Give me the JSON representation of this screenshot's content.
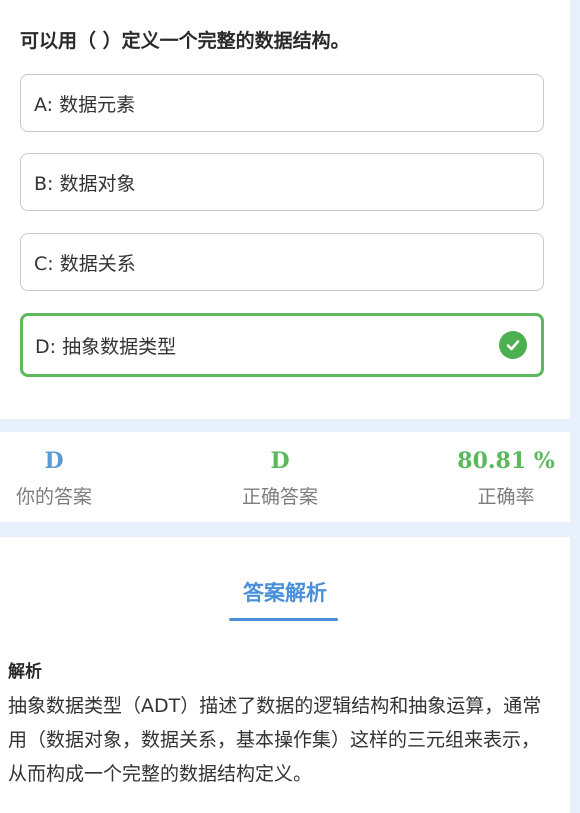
{
  "question": {
    "text": "可以用（ ）定义一个完整的数据结构。",
    "options": [
      {
        "label": "A: 数据元素",
        "correct": false
      },
      {
        "label": "B: 数据对象",
        "correct": false
      },
      {
        "label": "C: 数据关系",
        "correct": false
      },
      {
        "label": "D: 抽象数据类型",
        "correct": true
      }
    ],
    "correct_icon": "check-circle-icon"
  },
  "stats": {
    "your_answer": {
      "value": "D",
      "label": "你的答案"
    },
    "correct_answer": {
      "value": "D",
      "label": "正确答案"
    },
    "accuracy": {
      "value": "80.81 %",
      "label": "正确率"
    }
  },
  "analysis": {
    "title": "答案解析",
    "heading": "解析",
    "body": "抽象数据类型（ADT）描述了数据的逻辑结构和抽象运算，通常用（数据对象，数据关系，基本操作集）这样的三元组来表示，从而构成一个完整的数据结构定义。"
  },
  "colors": {
    "page_bg": "#e8f1fb",
    "correct_green": "#4caf50",
    "accent_blue": "#4a90d9",
    "your_answer_blue": "#5b9bd5",
    "correct_answer_green": "#5cb85c"
  }
}
